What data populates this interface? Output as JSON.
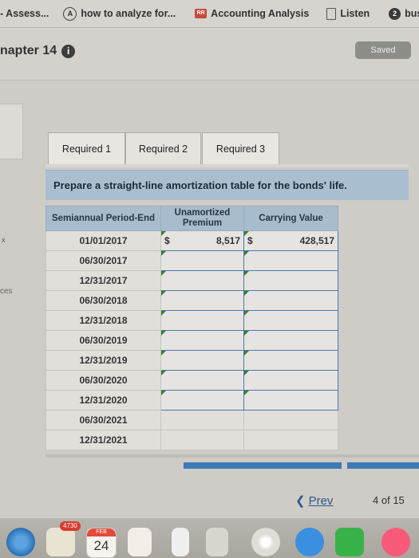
{
  "browser": {
    "tabs": [
      {
        "label": "- Assess...",
        "icon": "none"
      },
      {
        "label": "how to analyze for...",
        "icon": "chegg-icon"
      },
      {
        "label": "Accounting Analysis",
        "icon": "rr-icon"
      },
      {
        "label": "Listen",
        "icon": "doc-icon"
      },
      {
        "label": "busin",
        "icon": "business-icon"
      }
    ]
  },
  "header": {
    "chapter": "napter 14",
    "info_icon": "i",
    "saved_label": "Saved"
  },
  "sidebar": {
    "x_text": "x",
    "ces_text": "ces"
  },
  "tabs": {
    "req1": "Required 1",
    "req2": "Required 2",
    "req3": "Required 3"
  },
  "instruction": "Prepare a straight-line amortization table for the bonds' life.",
  "table": {
    "headers": [
      "Semiannual Period-End",
      "Unamortized Premium",
      "Carrying Value"
    ],
    "rows": [
      {
        "date": "01/01/2017",
        "premium_currency": "$",
        "premium": "8,517",
        "carrying_currency": "$",
        "carrying": "428,517"
      },
      {
        "date": "06/30/2017"
      },
      {
        "date": "12/31/2017"
      },
      {
        "date": "06/30/2018"
      },
      {
        "date": "12/31/2018"
      },
      {
        "date": "06/30/2019"
      },
      {
        "date": "12/31/2019"
      },
      {
        "date": "06/30/2020"
      },
      {
        "date": "12/31/2020"
      },
      {
        "date": "06/30/2021"
      },
      {
        "date": "12/31/2021"
      }
    ]
  },
  "nav": {
    "prev_label": "Prev",
    "page_current": "4",
    "page_sep": "of",
    "page_total": "15"
  },
  "dock": {
    "badge_count": "4730",
    "calendar_month": "FEB",
    "calendar_day": "24"
  }
}
